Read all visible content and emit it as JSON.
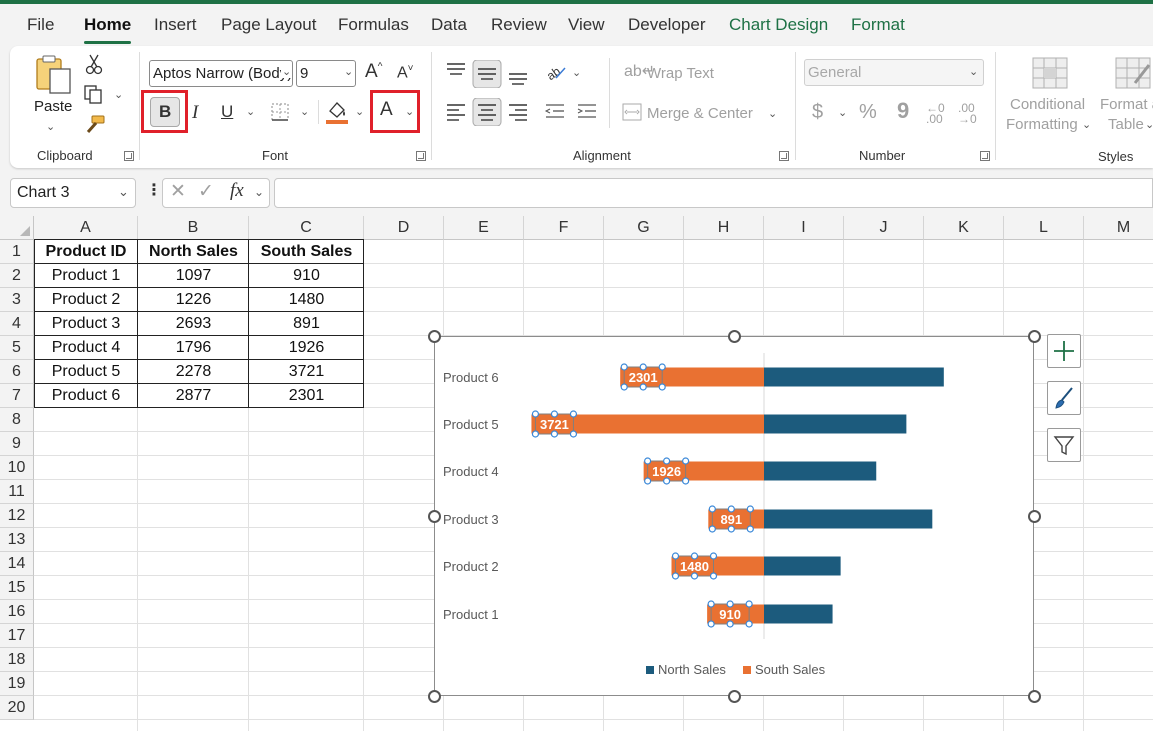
{
  "menu": {
    "tabs": [
      "File",
      "Home",
      "Insert",
      "Page Layout",
      "Formulas",
      "Data",
      "Review",
      "View",
      "Developer",
      "Chart Design",
      "Format"
    ],
    "active_tab": "Home"
  },
  "ribbon": {
    "clipboard": {
      "label": "Clipboard",
      "paste_label": "Paste"
    },
    "font": {
      "label": "Font",
      "font_name": "Aptos Narrow (Body)",
      "font_size": "9",
      "bold_glyph": "B",
      "italic_glyph": "I",
      "underline_glyph": "U",
      "font_color_glyph": "A",
      "grow_glyph": "A",
      "shrink_glyph": "A"
    },
    "alignment": {
      "label": "Alignment",
      "wrap_text": "Wrap Text",
      "merge_center": "Merge & Center"
    },
    "number": {
      "label": "Number",
      "format": "General",
      "currency": "$",
      "percent": "%",
      "comma": "9"
    },
    "styles": {
      "label": "Styles",
      "conditional_line1": "Conditional",
      "conditional_line2": "Formatting",
      "format_table_line1": "Format as",
      "format_table_line2": "Table"
    }
  },
  "formula_bar": {
    "name_box": "Chart 3",
    "fx": "fx",
    "formula": ""
  },
  "grid": {
    "columns": [
      "A",
      "B",
      "C",
      "D",
      "E",
      "F",
      "G",
      "H",
      "I",
      "J",
      "K",
      "L",
      "M"
    ],
    "rows": [
      "1",
      "2",
      "3",
      "4",
      "5",
      "6",
      "7",
      "8",
      "9",
      "10",
      "11",
      "12",
      "13",
      "14",
      "15",
      "16",
      "17",
      "18",
      "19",
      "20"
    ]
  },
  "table": {
    "headers": [
      "Product ID",
      "North Sales",
      "South Sales"
    ],
    "rows": [
      [
        "Product 1",
        "1097",
        "910"
      ],
      [
        "Product 2",
        "1226",
        "1480"
      ],
      [
        "Product 3",
        "2693",
        "891"
      ],
      [
        "Product 4",
        "1796",
        "1926"
      ],
      [
        "Product 5",
        "2278",
        "3721"
      ],
      [
        "Product 6",
        "2877",
        "2301"
      ]
    ]
  },
  "chart_data": {
    "type": "bar",
    "orientation": "horizontal-butterfly",
    "categories": [
      "Product 1",
      "Product 2",
      "Product 3",
      "Product 4",
      "Product 5",
      "Product 6"
    ],
    "series": [
      {
        "name": "North Sales",
        "values": [
          1097,
          1226,
          2693,
          1796,
          2278,
          2877
        ],
        "color": "#1c5b7d",
        "direction": "right"
      },
      {
        "name": "South Sales",
        "values": [
          910,
          1480,
          891,
          1926,
          3721,
          2301
        ],
        "color": "#e97132",
        "direction": "left",
        "data_labels": true
      }
    ],
    "legend": "bottom",
    "grid": false,
    "xlim": [
      -4000,
      4000
    ]
  }
}
